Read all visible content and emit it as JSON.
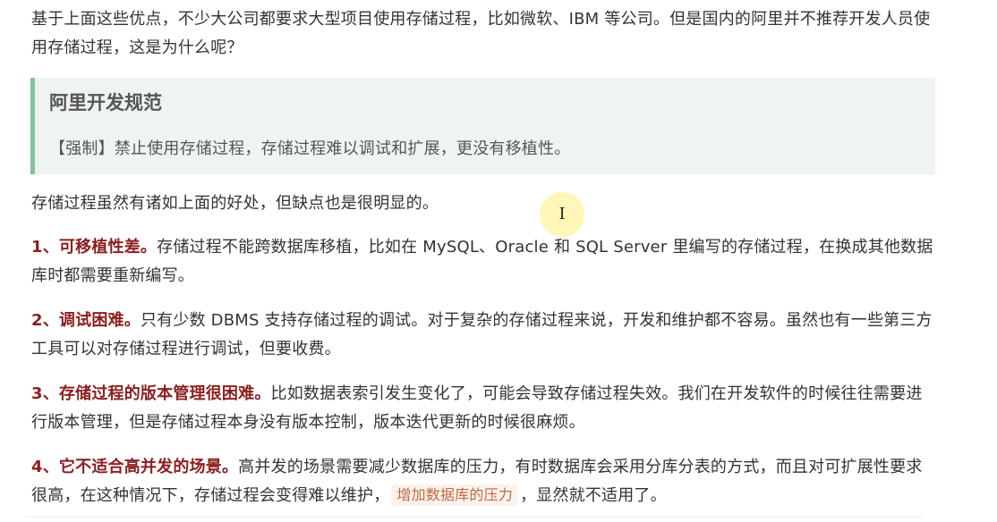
{
  "intro": {
    "text": "基于上面这些优点，不少大公司都要求大型项目使用存储过程，比如微软、IBM 等公司。但是国内的阿里并不推荐开发人员使用存储过程，这是为什么呢？"
  },
  "callout": {
    "title": "阿里开发规范",
    "text": "【强制】禁止使用存储过程，存储过程难以调试和扩展，更没有移植性。"
  },
  "summary": {
    "text": "存储过程虽然有诸如上面的好处，但缺点也是很明显的。"
  },
  "points": [
    {
      "heading": "1、可移植性差。",
      "body": "存储过程不能跨数据库移植，比如在 MySQL、Oracle 和 SQL Server 里编写的存储过程，在换成其他数据库时都需要重新编写。"
    },
    {
      "heading": "2、调试困难。",
      "body": "只有少数 DBMS 支持存储过程的调试。对于复杂的存储过程来说，开发和维护都不容易。虽然也有一些第三方工具可以对存储过程进行调试，但要收费。"
    },
    {
      "heading": "3、存储过程的版本管理很困难。",
      "body": "比如数据表索引发生变化了，可能会导致存储过程失效。我们在开发软件的时候往往需要进行版本管理，但是存储过程本身没有版本控制，版本迭代更新的时候很麻烦。"
    },
    {
      "heading": "4、它不适合高并发的场景。",
      "body_before": "高并发的场景需要减少数据库的压力，有时数据库会采用分库分表的方式，而且对可扩展性要求很高，在这种情况下，存储过程会变得难以维护，",
      "highlight": "增加数据库的压力",
      "body_after": "，显然就不适用了。"
    }
  ],
  "cursor": {
    "glyph": "I"
  },
  "colors": {
    "heading_red": "#8b1f1f",
    "callout_bg": "#eef4ef",
    "callout_border": "#7fc59a",
    "highlight_text": "#c26a3d"
  }
}
